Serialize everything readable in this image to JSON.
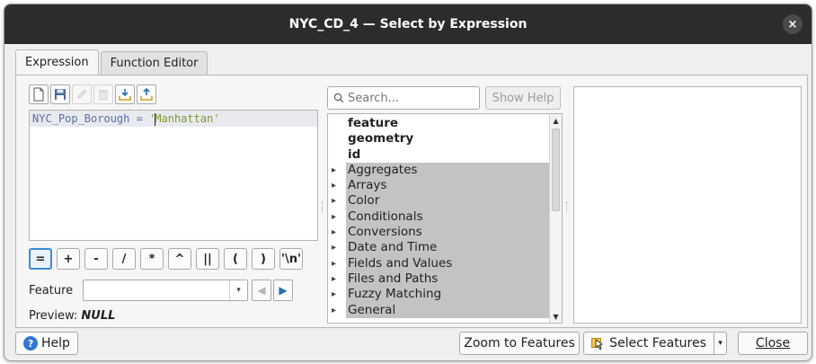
{
  "window": {
    "title": "NYC_CD_4 — Select by Expression",
    "close_glyph": "×"
  },
  "tabs": [
    {
      "label": "Expression",
      "active": true
    },
    {
      "label": "Function Editor",
      "active": false
    }
  ],
  "toolbar": {
    "icons": [
      "new-file-icon",
      "save-icon",
      "edit-icon",
      "delete-icon",
      "import-icon",
      "export-icon"
    ]
  },
  "expression": {
    "field": "NYC_Pop_Borough",
    "operator": " = ",
    "string_open": "'",
    "string_rest": "Manhattan'"
  },
  "operators": [
    "=",
    "+",
    "-",
    "/",
    "*",
    "^",
    "||",
    "(",
    ")",
    "'\\n'"
  ],
  "feature": {
    "label": "Feature",
    "value": ""
  },
  "preview": {
    "label": "Preview:",
    "value": "NULL"
  },
  "search": {
    "placeholder": "Search...",
    "show_help_label": "Show Help"
  },
  "function_list": {
    "top_items": [
      "feature",
      "geometry",
      "id"
    ],
    "groups": [
      "Aggregates",
      "Arrays",
      "Color",
      "Conditionals",
      "Conversions",
      "Date and Time",
      "Fields and Values",
      "Files and Paths",
      "Fuzzy Matching",
      "General"
    ]
  },
  "buttons": {
    "help": "Help",
    "zoom_to_features": "Zoom to Features",
    "select_features": "Select Features",
    "close": "Close"
  },
  "colors": {
    "titlebar": "#2c2c2c",
    "group_highlight": "#c3c3c3",
    "string_literal": "#7f9a27",
    "field_name": "#5a6fa0",
    "accent": "#3d8bd6"
  }
}
